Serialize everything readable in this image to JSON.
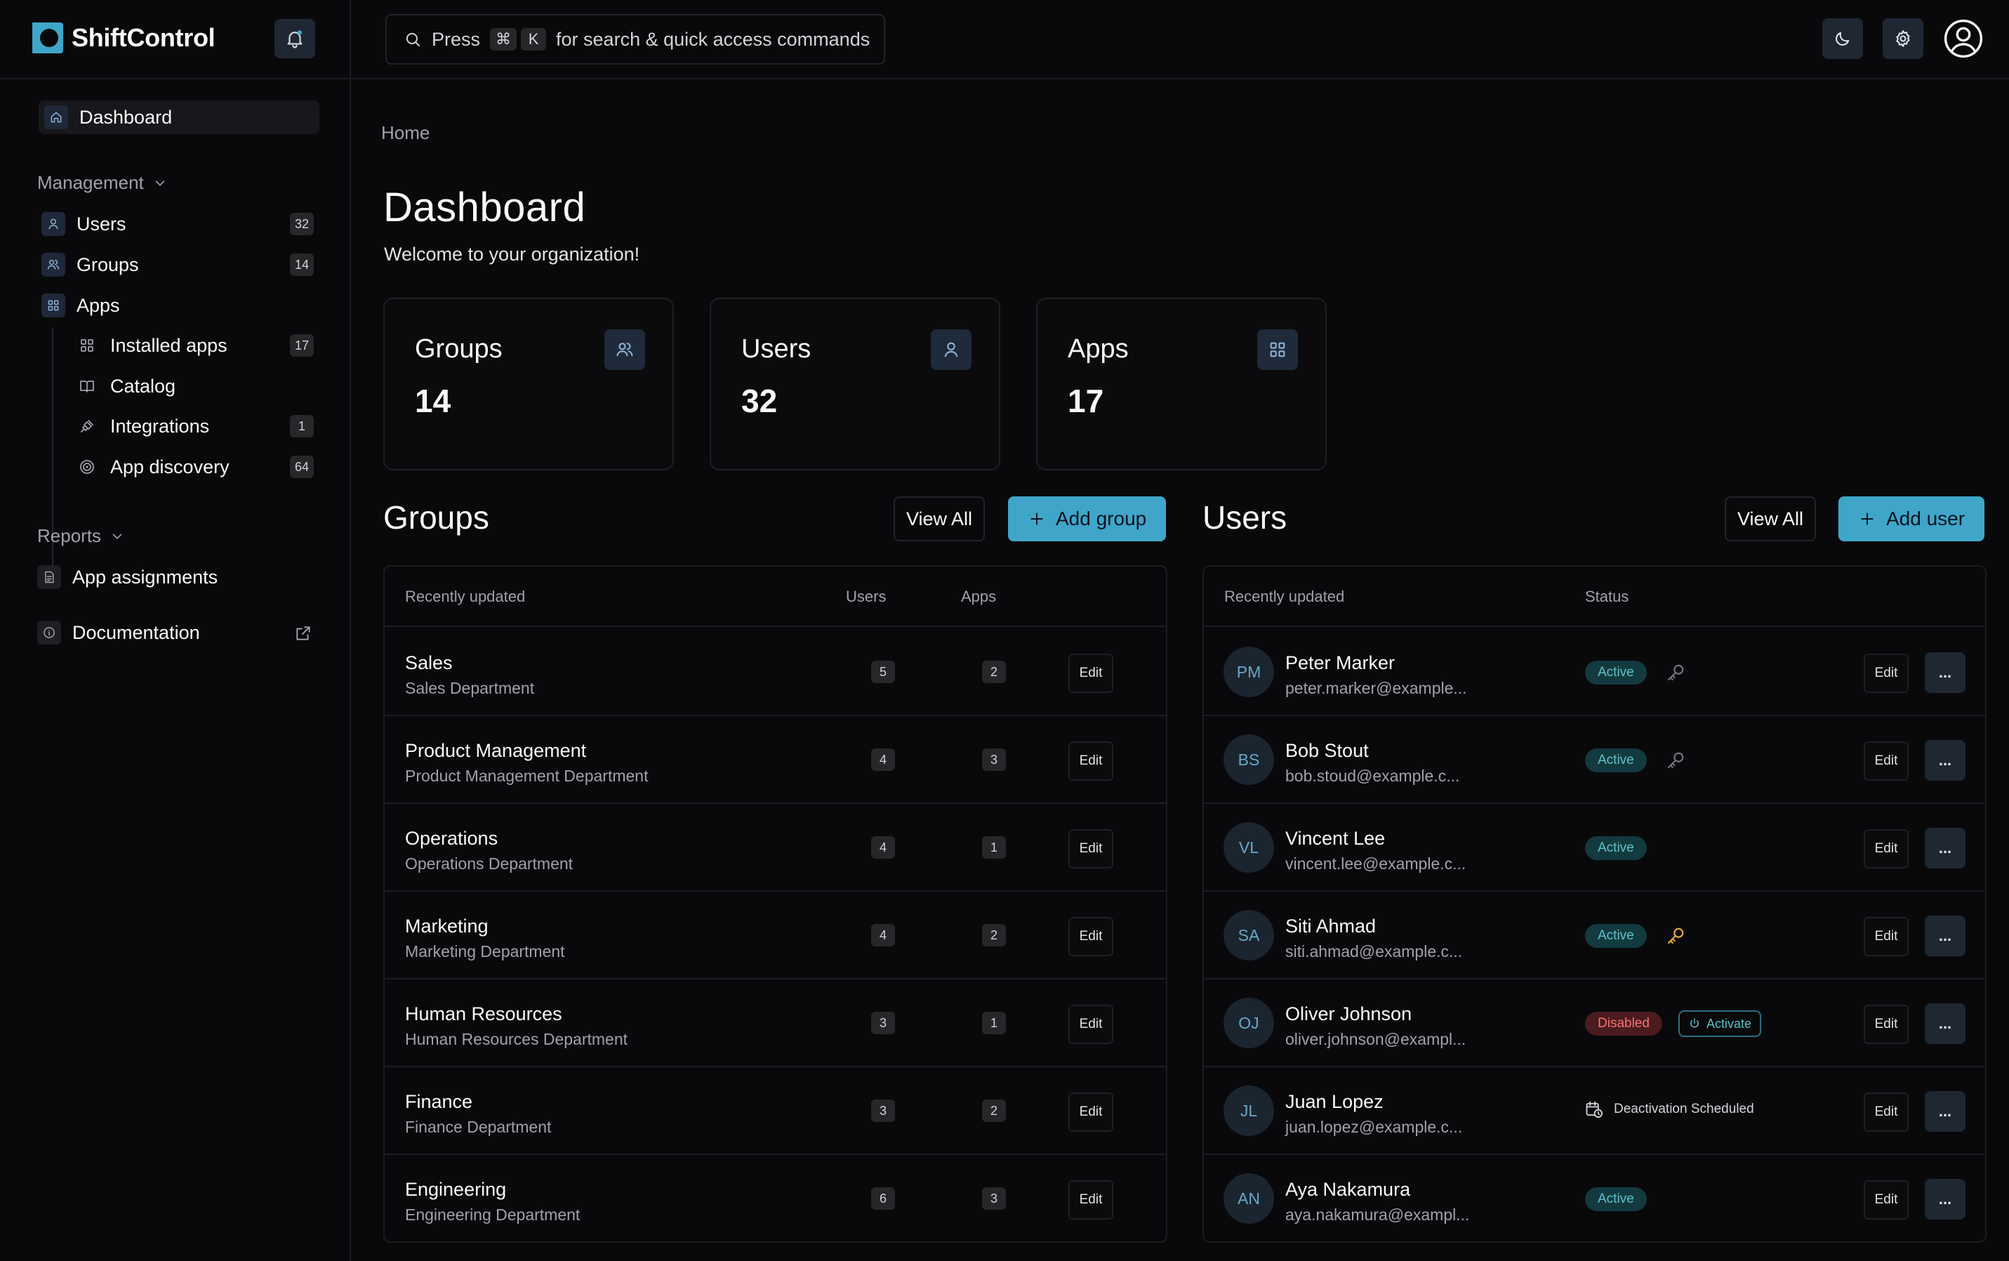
{
  "app": {
    "name": "ShiftControl"
  },
  "colors": {
    "accent": "#3fa6c9",
    "background": "#09090b",
    "active": "#5cc3c9",
    "disabled": "#f87171",
    "key_highlight": "#e0a34a"
  },
  "search": {
    "prefix": "Press",
    "keys": [
      "⌘",
      "K"
    ],
    "suffix": "for search & quick access commands"
  },
  "header_icons": [
    "bell-icon",
    "moon-icon",
    "gear-icon",
    "user-circle-icon"
  ],
  "sidebar": {
    "dashboard": "Dashboard",
    "management_label": "Management",
    "management": [
      {
        "label": "Users",
        "count": "32",
        "icon": "user-icon"
      },
      {
        "label": "Groups",
        "count": "14",
        "icon": "users-icon"
      },
      {
        "label": "Apps",
        "count": "",
        "icon": "grid-icon"
      }
    ],
    "apps_children": [
      {
        "label": "Installed apps",
        "count": "17",
        "icon": "grid-icon"
      },
      {
        "label": "Catalog",
        "count": "",
        "icon": "book-icon"
      },
      {
        "label": "Integrations",
        "count": "1",
        "icon": "plug-icon"
      },
      {
        "label": "App discovery",
        "count": "64",
        "icon": "target-icon"
      }
    ],
    "reports_label": "Reports",
    "reports": [
      {
        "label": "App assignments",
        "icon": "report-icon"
      }
    ],
    "documentation": "Documentation"
  },
  "main": {
    "breadcrumb": "Home",
    "title": "Dashboard",
    "subtitle": "Welcome to your organization!",
    "stats": [
      {
        "label": "Groups",
        "value": "14",
        "icon": "users-icon"
      },
      {
        "label": "Users",
        "value": "32",
        "icon": "user-icon"
      },
      {
        "label": "Apps",
        "value": "17",
        "icon": "grid-icon"
      }
    ]
  },
  "groups": {
    "title": "Groups",
    "view_all": "View All",
    "add_label": "Add group",
    "columns": [
      "Recently updated",
      "Users",
      "Apps"
    ],
    "edit_label": "Edit",
    "rows": [
      {
        "name": "Sales",
        "desc": "Sales Department",
        "users": "5",
        "apps": "2"
      },
      {
        "name": "Product Management",
        "desc": "Product Management Department",
        "users": "4",
        "apps": "3"
      },
      {
        "name": "Operations",
        "desc": "Operations Department",
        "users": "4",
        "apps": "1"
      },
      {
        "name": "Marketing",
        "desc": "Marketing Department",
        "users": "4",
        "apps": "2"
      },
      {
        "name": "Human Resources",
        "desc": "Human Resources Department",
        "users": "3",
        "apps": "1"
      },
      {
        "name": "Finance",
        "desc": "Finance Department",
        "users": "3",
        "apps": "2"
      },
      {
        "name": "Engineering",
        "desc": "Engineering Department",
        "users": "6",
        "apps": "3"
      }
    ]
  },
  "users": {
    "title": "Users",
    "view_all": "View All",
    "add_label": "Add user",
    "columns": [
      "Recently updated",
      "Status"
    ],
    "edit_label": "Edit",
    "more_label": "...",
    "activate_label": "Activate",
    "rows": [
      {
        "initials": "PM",
        "name": "Peter Marker",
        "email": "peter.marker@example...",
        "status": "Active",
        "key": "grey"
      },
      {
        "initials": "BS",
        "name": "Bob Stout",
        "email": "bob.stoud@example.c...",
        "status": "Active",
        "key": "grey"
      },
      {
        "initials": "VL",
        "name": "Vincent Lee",
        "email": "vincent.lee@example.c...",
        "status": "Active",
        "key": ""
      },
      {
        "initials": "SA",
        "name": "Siti Ahmad",
        "email": "siti.ahmad@example.c...",
        "status": "Active",
        "key": "orange"
      },
      {
        "initials": "OJ",
        "name": "Oliver Johnson",
        "email": "oliver.johnson@exampl...",
        "status": "Disabled",
        "key": ""
      },
      {
        "initials": "JL",
        "name": "Juan Lopez",
        "email": "juan.lopez@example.c...",
        "status": "Deactivation Scheduled",
        "key": ""
      },
      {
        "initials": "AN",
        "name": "Aya Nakamura",
        "email": "aya.nakamura@exampl...",
        "status": "Active",
        "key": ""
      }
    ]
  }
}
